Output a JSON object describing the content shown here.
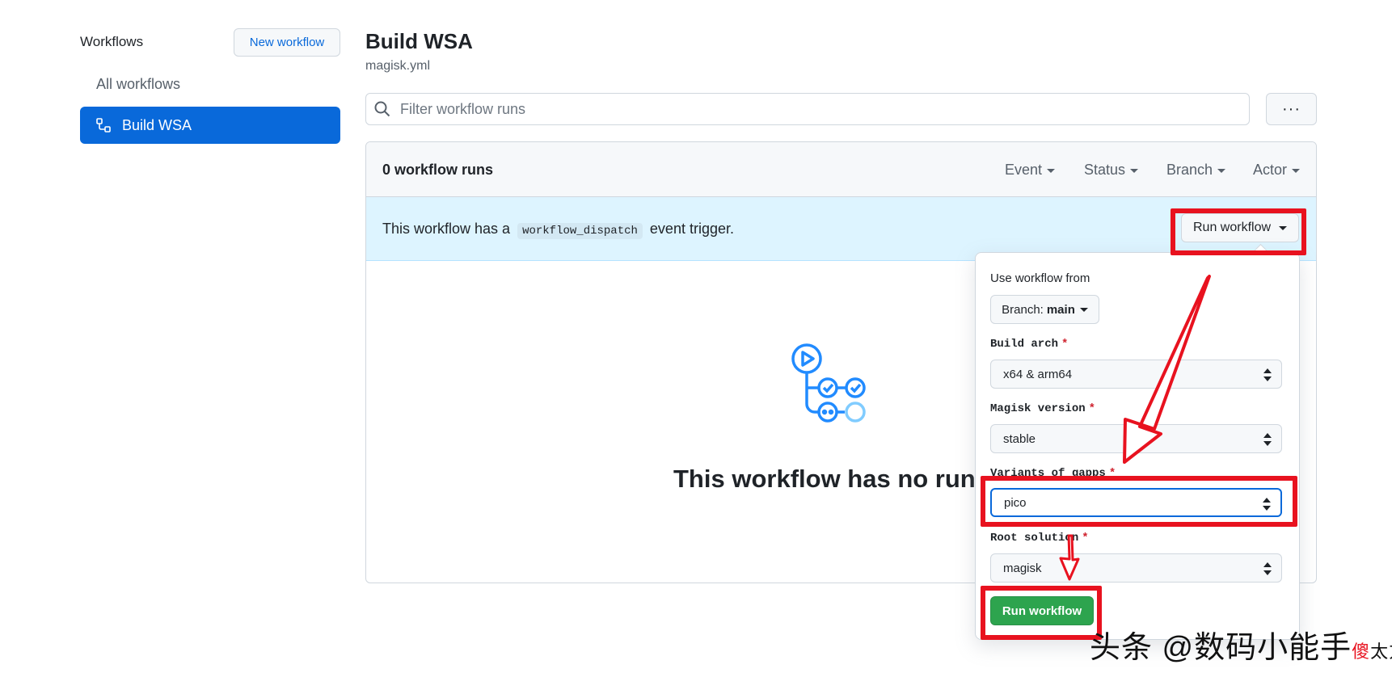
{
  "sidebar": {
    "title": "Workflows",
    "new_workflow_label": "New workflow",
    "all_workflows_label": "All workflows",
    "active_item_label": "Build WSA"
  },
  "header": {
    "title": "Build WSA",
    "subtitle": "magisk.yml"
  },
  "filter": {
    "placeholder": "Filter workflow runs",
    "more_label": "···"
  },
  "runs": {
    "count_label": "0 workflow runs",
    "filters": [
      "Event",
      "Status",
      "Branch",
      "Actor"
    ],
    "dispatch_prefix": "This workflow has a",
    "dispatch_code": "workflow_dispatch",
    "dispatch_suffix": "event trigger.",
    "run_workflow_dropdown_label": "Run workflow",
    "empty_title": "This workflow has no runs y"
  },
  "panel": {
    "use_from_label": "Use workflow from",
    "branch_prefix": "Branch:",
    "branch_value": "main",
    "fields": [
      {
        "label": "Build arch",
        "value": "x64 & arm64"
      },
      {
        "label": "Magisk version",
        "value": "stable"
      },
      {
        "label": "Variants of gapps",
        "value": "pico"
      },
      {
        "label": "Root solution",
        "value": "magisk"
      }
    ],
    "required_mark": "*",
    "run_button_label": "Run workflow"
  },
  "watermark": {
    "main": "头条 @数码小能",
    "red_char": "傻",
    "small": "太方",
    "tail": "手"
  },
  "colors": {
    "accent": "#0969da",
    "success": "#2da44e",
    "annotation": "#e8121f",
    "dispatch_bg": "#ddf4ff"
  }
}
